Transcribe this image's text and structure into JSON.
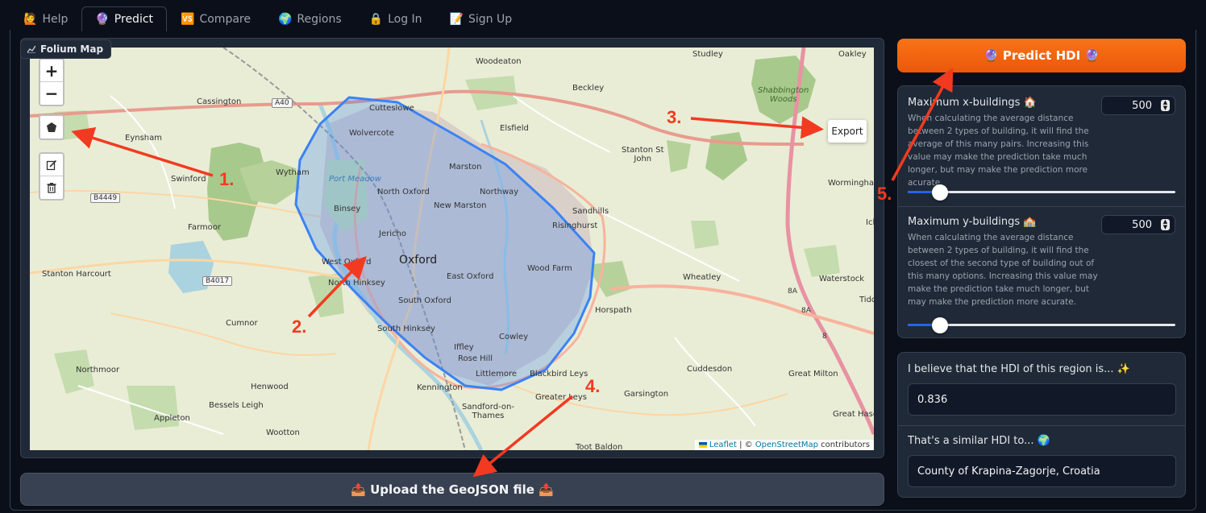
{
  "tabs": [
    {
      "icon": "🙋",
      "label": "Help"
    },
    {
      "icon": "🔮",
      "label": "Predict"
    },
    {
      "icon": "🆚",
      "label": "Compare"
    },
    {
      "icon": "🌍",
      "label": "Regions"
    },
    {
      "icon": "🔒",
      "label": "Log In"
    },
    {
      "icon": "📝",
      "label": "Sign Up"
    }
  ],
  "map": {
    "label": "Folium Map",
    "zoom_in": "+",
    "zoom_out": "−",
    "export_label": "Export",
    "attribution": {
      "leaflet": "Leaflet",
      "sep": " | © ",
      "osm": "OpenStreetMap",
      "suffix": " contributors"
    },
    "places": {
      "oakley": "Oakley",
      "studley": "Studley",
      "woodeaton": "Woodeaton",
      "beckley": "Beckley",
      "cassington": "Cassington",
      "a40": "A40",
      "cutteslowe": "Cutteslowe",
      "elsfield": "Elsfield",
      "shabbington": "Shabbington\nWoods",
      "eynsham": "Eynsham",
      "wolvercote": "Wolvercote",
      "stanton_st_john": "Stanton St\nJohn",
      "wytham": "Wytham",
      "port_meadow": "Port Meadow",
      "marston": "Marston",
      "swinford": "Swinford",
      "north_oxford": "North Oxford",
      "northway": "Northway",
      "worminghall": "Worminghal",
      "b4449": "B4449",
      "new_marston": "New Marston",
      "sandhills": "Sandhills",
      "binsey": "Binsey",
      "risinghurst": "Risinghurst",
      "farmoor": "Farmoor",
      "jericho": "Jericho",
      "ick": "Ick",
      "oxford": "Oxford",
      "west_oxford": "West Oxford",
      "wood_farm": "Wood Farm",
      "stanton_harcourt": "Stanton Harcourt",
      "east_oxford": "East Oxford",
      "wheatley": "Wheatley",
      "b4017": "B4017",
      "north_hinksey": "North Hinksey",
      "waterstock": "Waterstock",
      "south_oxford": "South Oxford",
      "tidd": "Tidd",
      "horspath": "Horspath",
      "cumnor": "Cumnor",
      "south_hinksey": "South Hinksey",
      "cowley": "Cowley",
      "iffley": "Iffley",
      "rose_hill": "Rose Hill",
      "cuddesdon": "Cuddesdon",
      "northmoor": "Northmoor",
      "littlemore": "Littlemore",
      "blackbird_leys": "Blackbird Leys",
      "great_milton": "Great Milton",
      "henwood": "Henwood",
      "kennington": "Kennington",
      "greater_leys": "Greater Leys",
      "garsington": "Garsington",
      "bessels_leigh": "Bessels Leigh",
      "sandford": "Sandford-on-\nThames",
      "great_haseley": "Great Hase",
      "appleton": "Appleton",
      "wootton": "Wootton",
      "toot_baldon": "Toot Baldon",
      "road_8a": "8A",
      "road_8a2": "8A",
      "road_8": "8"
    }
  },
  "upload": {
    "label": "📤 Upload the GeoJSON file 📤"
  },
  "predict": {
    "label": "🔮 Predict HDI 🔮"
  },
  "params": {
    "x": {
      "title": "Maximum x-buildings 🏠",
      "desc": "When calculating the average distance between 2 types of building, it will find the average of this many pairs. Increasing this value may make the prediction take much longer, but may make the prediction more acurate.",
      "value": "500",
      "slider_fraction": 0.12
    },
    "y": {
      "title": "Maximum y-buildings 🏫",
      "desc": "When calculating the average distance between 2 types of building, it will find the closest of the second type of building out of this many options. Increasing this value may make the prediction take much longer, but may make the prediction more acurate.",
      "value": "500",
      "slider_fraction": 0.12
    }
  },
  "output": {
    "hdi_label": "I believe that the HDI of this region is... ✨",
    "hdi_value": "0.836",
    "similar_label": "That's a similar HDI to... 🌍",
    "similar_value": "County of Krapina-Zagorje, Croatia"
  },
  "steps": [
    "1.",
    "2.",
    "3.",
    "4.",
    "5."
  ],
  "colors": {
    "accent": "#f97316",
    "slider": "#2563eb",
    "annotation": "#f23a20",
    "polygon": "#3b82f6"
  }
}
